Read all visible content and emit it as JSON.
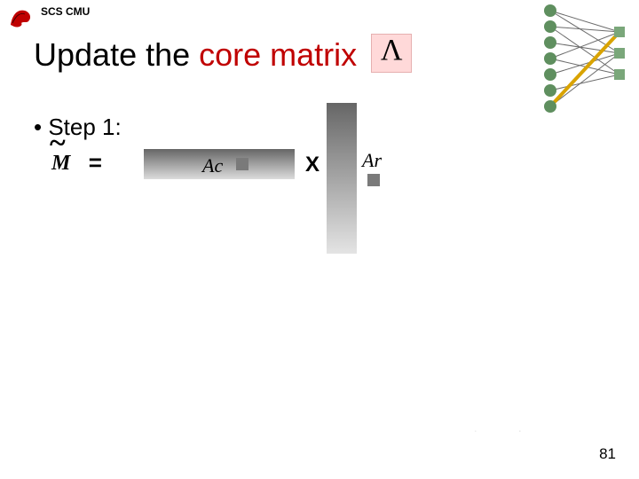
{
  "header": {
    "label": "SCS CMU"
  },
  "title": {
    "pre": "Update the ",
    "red": "core matrix "
  },
  "step": {
    "text": "•  Step 1:"
  },
  "equation": {
    "lhs": "M",
    "op": "=",
    "ac": "Ac",
    "mult": "X",
    "ar": "Ar"
  },
  "page": {
    "number": "81"
  }
}
